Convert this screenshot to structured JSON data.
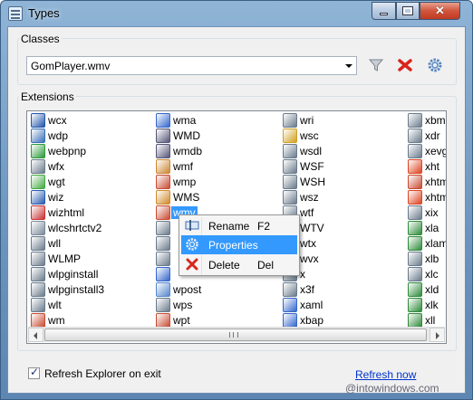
{
  "window": {
    "title": "Types"
  },
  "classes": {
    "label": "Classes",
    "selected": "GomPlayer.wmv"
  },
  "extensions": {
    "label": "Extensions",
    "columns": [
      [
        {
          "name": "wcx",
          "color": "#2255aa"
        },
        {
          "name": "wdp",
          "color": "#3a6fb8"
        },
        {
          "name": "webpnp",
          "color": "#2b9a3a"
        },
        {
          "name": "wfx",
          "color": "#6a7b8c"
        },
        {
          "name": "wgt",
          "color": "#44aa44"
        },
        {
          "name": "wiz",
          "color": "#2a5db0"
        },
        {
          "name": "wizhtml",
          "color": "#c83232"
        },
        {
          "name": "wlcshrtctv2",
          "color": "#7a8a9a"
        },
        {
          "name": "wll",
          "color": "#6a7b8c"
        },
        {
          "name": "WLMP",
          "color": "#6a7b8c"
        },
        {
          "name": "wlpginstall",
          "color": "#6a7b8c"
        },
        {
          "name": "wlpginstall3",
          "color": "#6a7b8c"
        },
        {
          "name": "wlt",
          "color": "#6a7b8c"
        },
        {
          "name": "wm",
          "color": "#c84b32"
        }
      ],
      [
        {
          "name": "wma",
          "color": "#3366cc"
        },
        {
          "name": "WMD",
          "color": "#555577"
        },
        {
          "name": "wmdb",
          "color": "#555577"
        },
        {
          "name": "wmf",
          "color": "#cc8833"
        },
        {
          "name": "wmp",
          "color": "#c84b32"
        },
        {
          "name": "WMS",
          "color": "#d08a2a"
        },
        {
          "name": "wmv",
          "color": "#c84b32",
          "selected": true
        },
        {
          "name": "",
          "color": "#6a7b8c"
        },
        {
          "name": "",
          "color": "#6a7b8c"
        },
        {
          "name": "",
          "color": "#6a7b8c"
        },
        {
          "name": "",
          "color": "#3366cc"
        },
        {
          "name": "wpost",
          "color": "#5588cc"
        },
        {
          "name": "wps",
          "color": "#6a7b8c"
        },
        {
          "name": "wpt",
          "color": "#c84b32"
        }
      ],
      [
        {
          "name": "wri",
          "color": "#6a7b8c"
        },
        {
          "name": "wsc",
          "color": "#d0a020"
        },
        {
          "name": "wsdl",
          "color": "#6a7b8c"
        },
        {
          "name": "WSF",
          "color": "#6a7b8c"
        },
        {
          "name": "WSH",
          "color": "#6a7b8c"
        },
        {
          "name": "wsz",
          "color": "#6a7b8c"
        },
        {
          "name": "wtf",
          "color": "#6a7b8c"
        },
        {
          "name": "WTV",
          "color": "#6a7b8c"
        },
        {
          "name": "wtx",
          "color": "#6a7b8c"
        },
        {
          "name": "wvx",
          "color": "#6a7b8c"
        },
        {
          "name": "x",
          "color": "#6a7b8c"
        },
        {
          "name": "x3f",
          "color": "#6a7b8c"
        },
        {
          "name": "xaml",
          "color": "#3366cc"
        },
        {
          "name": "xbap",
          "color": "#3366cc"
        }
      ],
      [
        {
          "name": "xbm",
          "color": "#6a7b8c"
        },
        {
          "name": "xdr",
          "color": "#6a7b8c"
        },
        {
          "name": "xevgr",
          "color": "#6a7b8c"
        },
        {
          "name": "xht",
          "color": "#dd4422"
        },
        {
          "name": "xhtml",
          "color": "#c84b32"
        },
        {
          "name": "xhtml",
          "color": "#dd4422"
        },
        {
          "name": "xix",
          "color": "#6a7b8c"
        },
        {
          "name": "xla",
          "color": "#2e8b3a"
        },
        {
          "name": "xlam",
          "color": "#2e8b3a"
        },
        {
          "name": "xlb",
          "color": "#6a7b8c"
        },
        {
          "name": "xlc",
          "color": "#6a7b8c"
        },
        {
          "name": "xld",
          "color": "#2e8b3a"
        },
        {
          "name": "xlk",
          "color": "#2e8b3a"
        },
        {
          "name": "xll",
          "color": "#2e8b3a"
        }
      ]
    ]
  },
  "context_menu": {
    "items": [
      {
        "label": "Rename",
        "shortcut": "F2",
        "icon": "rename-icon"
      },
      {
        "label": "Properties",
        "shortcut": "",
        "icon": "gear-icon",
        "highlighted": true
      },
      {
        "label": "Delete",
        "shortcut": "Del",
        "icon": "delete-icon"
      }
    ]
  },
  "footer": {
    "checkbox_label": "Refresh Explorer on exit",
    "checkbox_checked": true,
    "refresh_link": "Refresh now",
    "watermark": "@intowindows.com"
  }
}
